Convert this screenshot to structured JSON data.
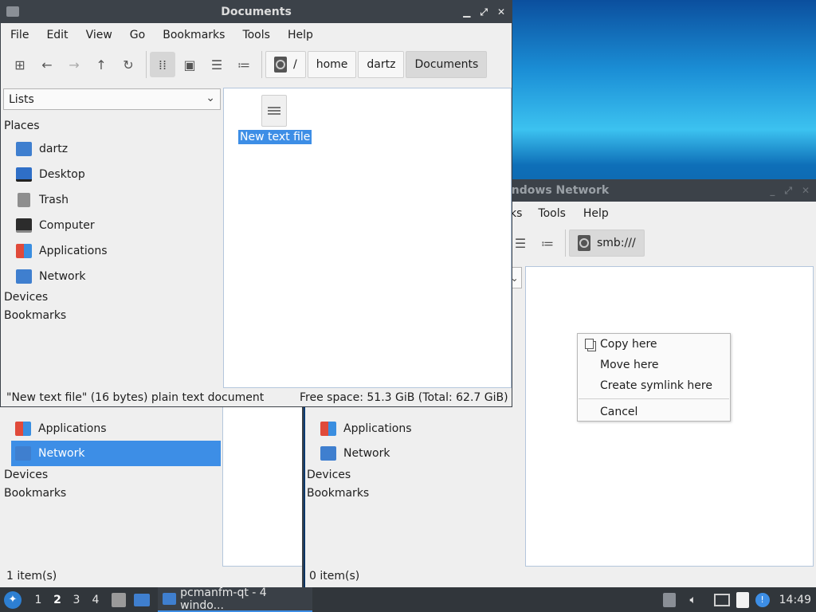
{
  "documents_window": {
    "title": "Documents",
    "menu": [
      "File",
      "Edit",
      "View",
      "Go",
      "Bookmarks",
      "Tools",
      "Help"
    ],
    "path": [
      "/",
      "home",
      "dartz",
      "Documents"
    ],
    "side_select": "Lists",
    "places_header": "Places",
    "places": [
      "dartz",
      "Desktop",
      "Trash",
      "Computer",
      "Applications",
      "Network"
    ],
    "devices_header": "Devices",
    "bookmarks_header": "Bookmarks",
    "file_name": "New text file",
    "status_left": "\"New text file\" (16 bytes) plain text document",
    "status_right": "Free space: 51.3 GiB (Total: 62.7 GiB)"
  },
  "network_window": {
    "title_fragment": "indows Network",
    "menu": [
      "ks",
      "Tools",
      "Help"
    ],
    "path": "smb:///",
    "places_visible": [
      "Applications",
      "Network"
    ],
    "devices_header": "Devices",
    "bookmarks_header": "Bookmarks",
    "status": "0 item(s)"
  },
  "back_window": {
    "places_visible": [
      "Applications",
      "Network"
    ],
    "devices_header": "Devices",
    "bookmarks_header": "Bookmarks",
    "status": "1 item(s)"
  },
  "context_menu": {
    "items": [
      "Copy here",
      "Move here",
      "Create symlink here",
      "Cancel"
    ]
  },
  "taskbar": {
    "desktops": [
      "1",
      "2",
      "3",
      "4"
    ],
    "active_desktop": "2",
    "task_label": "pcmanfm-qt - 4 windo...",
    "clock": "14:49"
  }
}
